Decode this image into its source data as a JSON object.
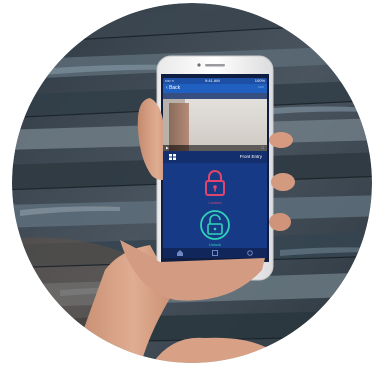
{
  "app": {
    "status_bar": {
      "carrier": "•••• ≈",
      "time": "9:41 AM",
      "battery": "100%"
    },
    "nav": {
      "back_label": "Back"
    },
    "camera": {
      "title": "",
      "timestamp": "",
      "live_label": ""
    },
    "lock": {
      "name": "Front Entry"
    },
    "locked_state": {
      "label": "Locked"
    },
    "unlock_action": {
      "label": "Unlock"
    }
  },
  "colors": {
    "screen_bg": "#173a86",
    "nav_blue": "#1f60c0",
    "locked_red": "#e0466b",
    "unlock_teal": "#2fd3b8",
    "wood_dark": "#34404a",
    "wood_light": "#6f7a80"
  },
  "icons": [
    "padlock-locked-icon",
    "padlock-unlocked-icon",
    "grid-icon",
    "back-chevron-icon"
  ]
}
